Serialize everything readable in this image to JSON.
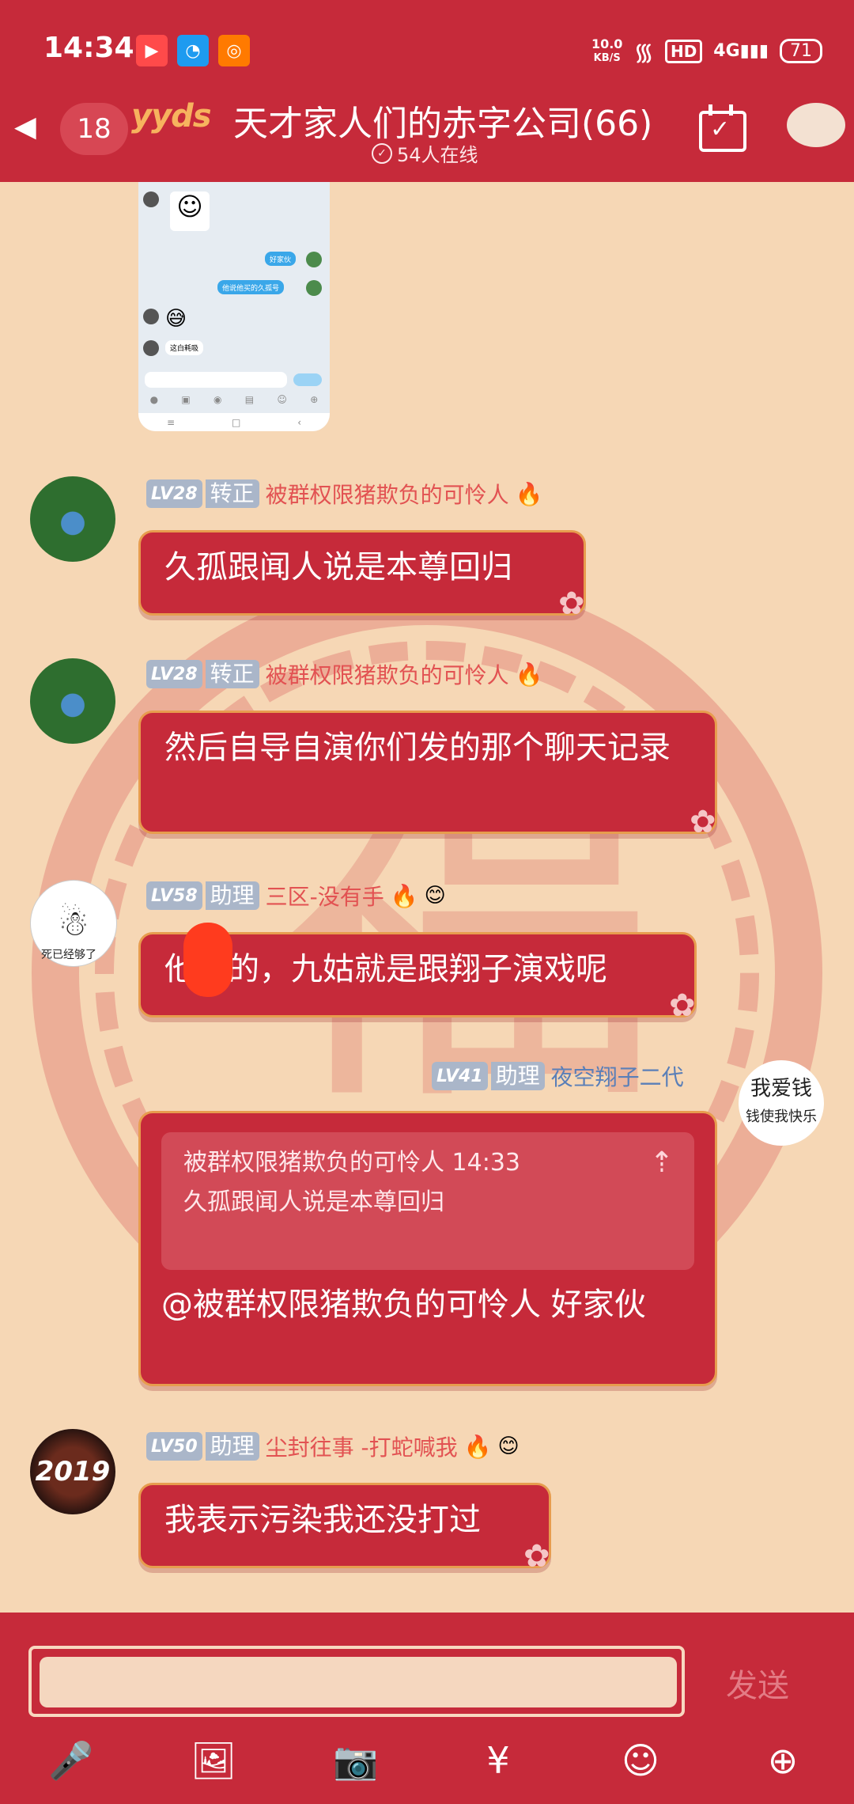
{
  "status_bar": {
    "time": "14:34",
    "net_speed_value": "10.0",
    "net_speed_unit": "KB/S",
    "hd": "HD",
    "signal": "4G",
    "battery": "71"
  },
  "header": {
    "back_icon": "back-arrow-icon",
    "unread_count": "18",
    "badge_text": "yyds",
    "group_title": "天才家人们的赤字公司(66)",
    "online_text": "54人在线"
  },
  "shared_image": {
    "bubble1": "好家伙",
    "bubble2": "他说他买的久孤号",
    "bubble3": "这白耗吸"
  },
  "messages": [
    {
      "level": "LV28",
      "role": "转正",
      "nick": "被群权限猪欺负的可怜人",
      "text": "久孤跟闻人说是本尊回归"
    },
    {
      "level": "LV28",
      "role": "转正",
      "nick": "被群权限猪欺负的可怜人",
      "text": "然后自导自演你们发的那个聊天记录"
    },
    {
      "level": "LV58",
      "role": "助理",
      "nick": "三区-没有手",
      "avatar_caption": "死已经够了",
      "text": "他妈的，九姑就是跟翔子演戏呢"
    },
    {
      "level": "LV41",
      "role": "助理",
      "nick": "夜空翔子二代",
      "avatar_line1": "我爱钱",
      "avatar_line2": "钱使我快乐",
      "quote_header": "被群权限猪欺负的可怜人 14:33",
      "quote_text": "久孤跟闻人说是本尊回归",
      "text": "@被群权限猪欺负的可怜人 好家伙"
    },
    {
      "level": "LV50",
      "role": "助理",
      "nick": "尘封往事 -打蛇喊我",
      "avatar_text": "2019",
      "text": "我表示污染我还没打过"
    }
  ],
  "input": {
    "placeholder": "",
    "send_label": "发送"
  },
  "toolbar": {
    "items": [
      "mic-icon",
      "image-icon",
      "camera-icon",
      "red-envelope-icon",
      "emoji-icon",
      "plus-icon"
    ]
  },
  "colors": {
    "primary_red": "#c62a3a",
    "background": "#f6d7b5",
    "nick_red": "#e25252"
  }
}
